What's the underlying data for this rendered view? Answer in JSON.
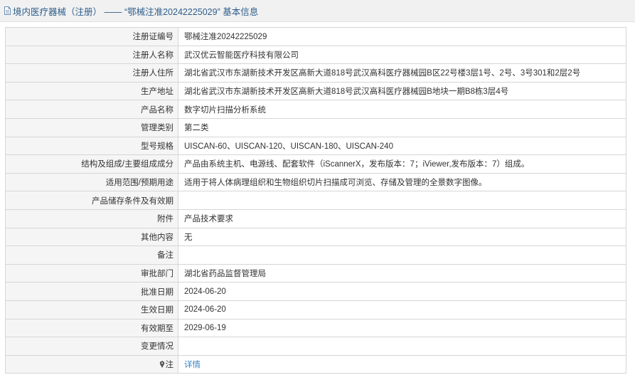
{
  "header": {
    "title": "境内医疗器械（注册） —— “鄂械注准20242225029” 基本信息",
    "icon": "document-icon"
  },
  "rows": [
    {
      "label": "注册证编号",
      "value": "鄂械注准20242225029"
    },
    {
      "label": "注册人名称",
      "value": "武汉优云智能医疗科技有限公司"
    },
    {
      "label": "注册人住所",
      "value": "湖北省武汉市东湖新技术开发区高新大道818号武汉高科医疗器械园B区22号楼3层1号、2号、3号301和2层2号"
    },
    {
      "label": "生产地址",
      "value": "湖北省武汉市东湖新技术开发区高新大道818号武汉高科医疗器械园B地块一期B8栋3层4号"
    },
    {
      "label": "产品名称",
      "value": "数字切片扫描分析系统"
    },
    {
      "label": "管理类别",
      "value": "第二类"
    },
    {
      "label": "型号规格",
      "value": "UISCAN-60、UISCAN-120、UISCAN-180、UISCAN-240"
    },
    {
      "label": "结构及组成/主要组成成分",
      "value": "产品由系统主机、电源线、配套软件（iScannerX，发布版本：7；iViewer,发布版本：7）组成。"
    },
    {
      "label": "适用范围/预期用途",
      "value": "适用于将人体病理组织和生物组织切片扫描成可浏览、存储及管理的全景数字图像。"
    },
    {
      "label": "产品储存条件及有效期",
      "value": ""
    },
    {
      "label": "附件",
      "value": "产品技术要求"
    },
    {
      "label": "其他内容",
      "value": "无"
    },
    {
      "label": "备注",
      "value": ""
    },
    {
      "label": "审批部门",
      "value": "湖北省药品监督管理局"
    },
    {
      "label": "批准日期",
      "value": "2024-06-20"
    },
    {
      "label": "生效日期",
      "value": "2024-06-20"
    },
    {
      "label": "有效期至",
      "value": "2029-06-19"
    },
    {
      "label": "变更情况",
      "value": ""
    }
  ],
  "note_row": {
    "icon": "pin-icon",
    "label": "注",
    "link": "详情"
  }
}
